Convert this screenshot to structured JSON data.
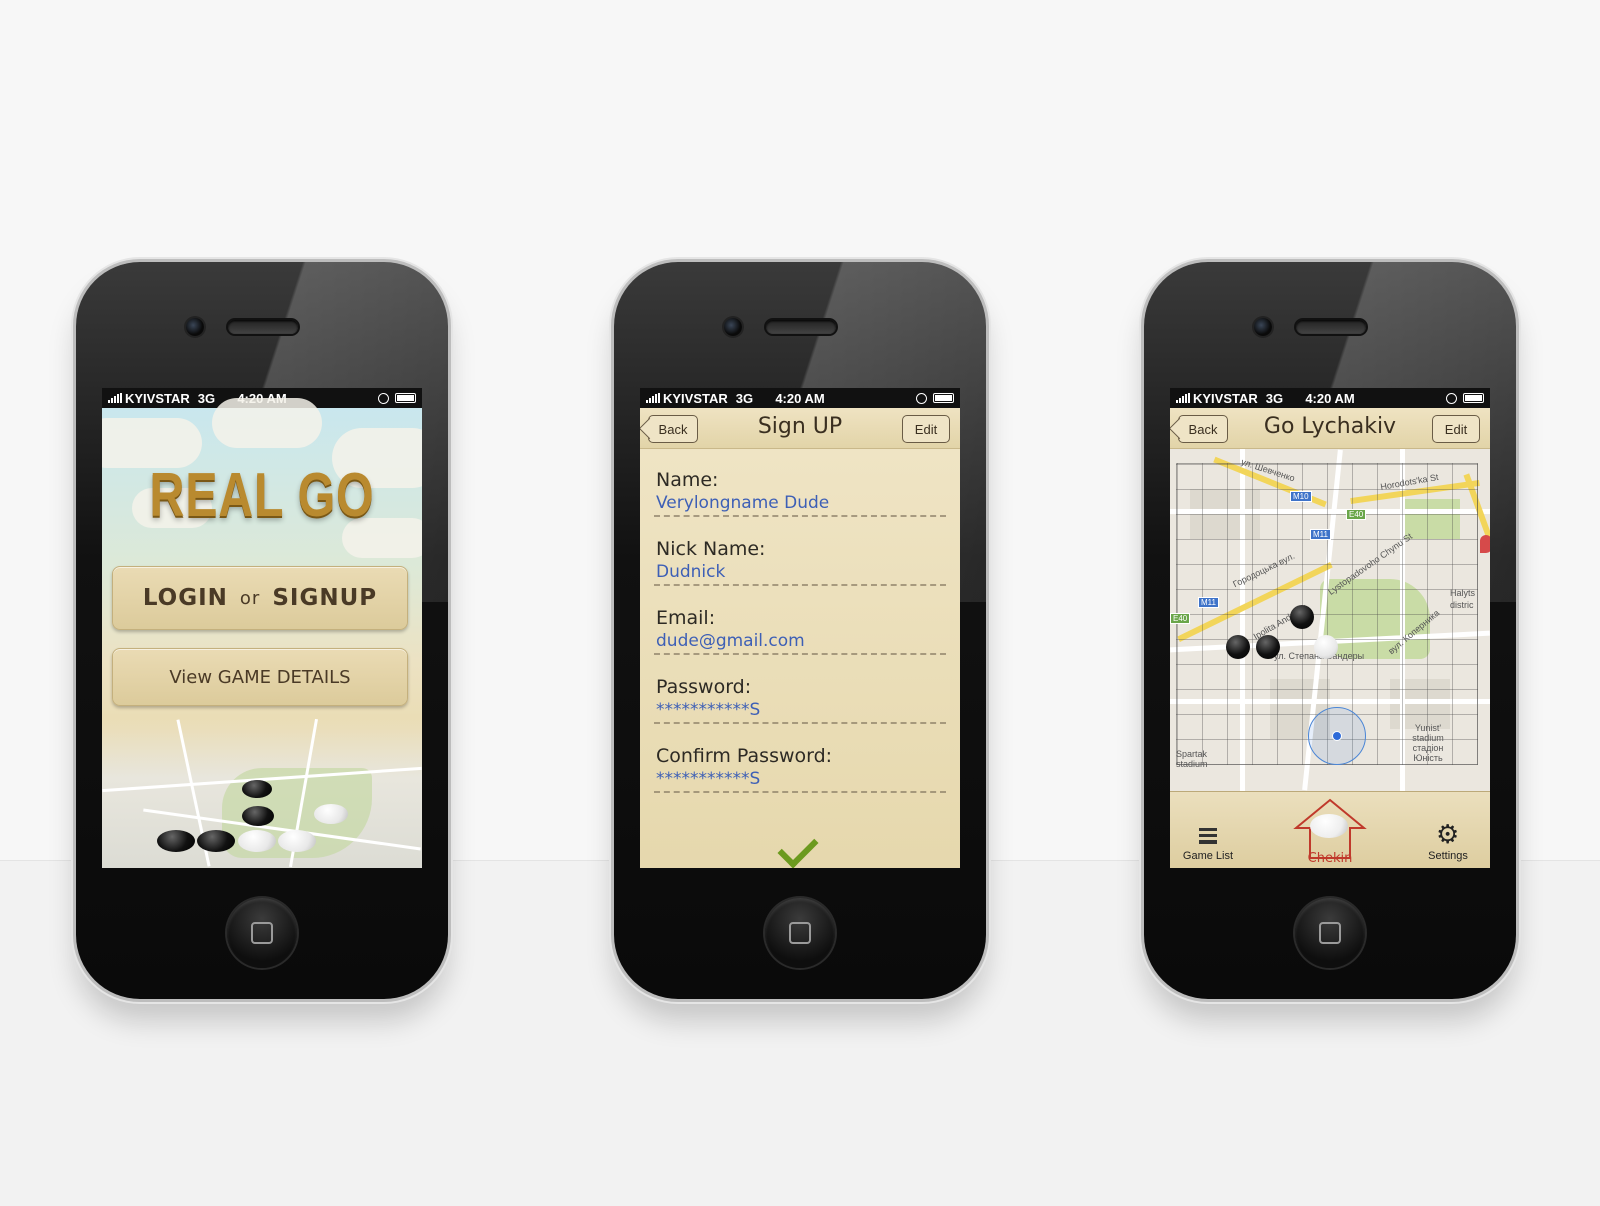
{
  "status_bar": {
    "carrier": "KYIVSTAR",
    "network": "3G",
    "time": "4:20 AM"
  },
  "screen1": {
    "logo": "REAL GO",
    "login_label": "LOGIN",
    "or_label": "or",
    "signup_label": "SIGNUP",
    "view_details_label": "View GAME DETAILS"
  },
  "screen2": {
    "title": "Sign UP",
    "back_label": "Back",
    "edit_label": "Edit",
    "fields": [
      {
        "label": "Name:",
        "value": "Verylongname Dude"
      },
      {
        "label": "Nick Name:",
        "value": "Dudnick"
      },
      {
        "label": "Email:",
        "value": "dude@gmail.com"
      },
      {
        "label": "Password:",
        "value": "***********S"
      },
      {
        "label": "Confirm Password:",
        "value": "***********S"
      }
    ]
  },
  "screen3": {
    "title": "Go Lychakiv",
    "back_label": "Back",
    "edit_label": "Edit",
    "map_labels": {
      "street1": "ул. Шевченко",
      "street2": "Horodots'ka St",
      "street3": "Городоцька вул.",
      "street4": "Lystopadovoho Chynu St",
      "street5": "Ipolita Andre St",
      "street6": "ул. Степана Бандеры",
      "street7": "вул. Коперника",
      "area1": "Halyts distric",
      "stadium1": "Spartak stadium",
      "stadium2": "Yunist' stadium стадіон Юність"
    },
    "shields": [
      "M10",
      "E40",
      "M11",
      "M11",
      "E40"
    ],
    "tabs": {
      "game_list": "Game List",
      "chekin": "Chekin",
      "settings": "Settings"
    }
  }
}
